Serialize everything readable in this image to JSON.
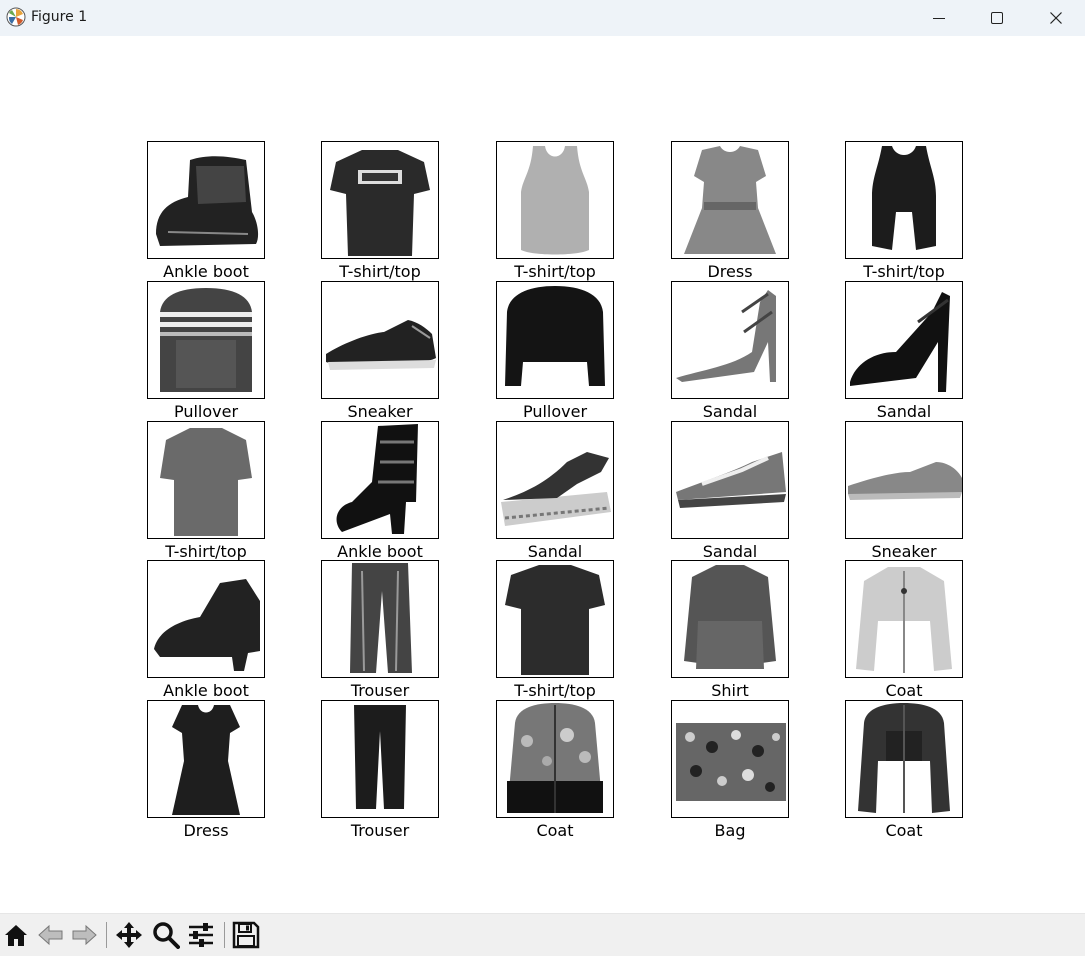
{
  "window": {
    "title": "Figure 1"
  },
  "figure": {
    "images": [
      {
        "label": "Ankle boot",
        "icon": "ankle-boot"
      },
      {
        "label": "T-shirt/top",
        "icon": "tshirt"
      },
      {
        "label": "T-shirt/top",
        "icon": "tank-top"
      },
      {
        "label": "Dress",
        "icon": "dress"
      },
      {
        "label": "T-shirt/top",
        "icon": "tank-top-dark"
      },
      {
        "label": "Pullover",
        "icon": "pullover-striped"
      },
      {
        "label": "Sneaker",
        "icon": "sneaker"
      },
      {
        "label": "Pullover",
        "icon": "pullover"
      },
      {
        "label": "Sandal",
        "icon": "sandal-heel"
      },
      {
        "label": "Sandal",
        "icon": "sandal-heel-dark"
      },
      {
        "label": "T-shirt/top",
        "icon": "tshirt-long"
      },
      {
        "label": "Ankle boot",
        "icon": "heel-boot"
      },
      {
        "label": "Sandal",
        "icon": "sandal-wedge"
      },
      {
        "label": "Sandal",
        "icon": "sandal-flat"
      },
      {
        "label": "Sneaker",
        "icon": "sneaker-light"
      },
      {
        "label": "Ankle boot",
        "icon": "ankle-boot-2"
      },
      {
        "label": "Trouser",
        "icon": "trouser-jeans"
      },
      {
        "label": "T-shirt/top",
        "icon": "tshirt-dark"
      },
      {
        "label": "Shirt",
        "icon": "shirt"
      },
      {
        "label": "Coat",
        "icon": "coat-light"
      },
      {
        "label": "Dress",
        "icon": "dress-dark"
      },
      {
        "label": "Trouser",
        "icon": "trouser"
      },
      {
        "label": "Coat",
        "icon": "coat-pattern"
      },
      {
        "label": "Bag",
        "icon": "bag-pattern"
      },
      {
        "label": "Coat",
        "icon": "coat-dark"
      }
    ]
  },
  "toolbar": {
    "buttons": [
      {
        "name": "home-button",
        "icon": "home-icon"
      },
      {
        "name": "back-button",
        "icon": "back-arrow-icon"
      },
      {
        "name": "forward-button",
        "icon": "forward-arrow-icon"
      },
      {
        "name": "pan-button",
        "icon": "move-icon"
      },
      {
        "name": "zoom-button",
        "icon": "magnifier-icon"
      },
      {
        "name": "configure-subplots-button",
        "icon": "sliders-icon"
      },
      {
        "name": "save-button",
        "icon": "floppy-disk-icon"
      }
    ]
  },
  "colors": {
    "titlebar_bg": "#eef3f8",
    "toolbar_bg": "#f0f0f0",
    "cell_border": "#000000"
  }
}
